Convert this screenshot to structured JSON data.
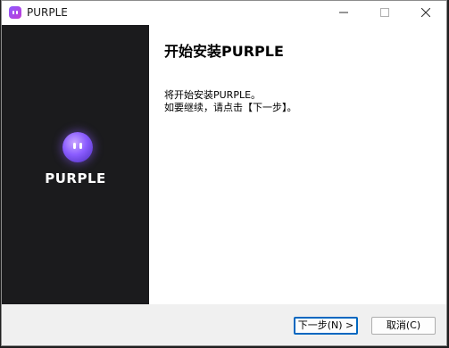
{
  "window": {
    "title": "PURPLE"
  },
  "sidebar": {
    "logo_text": "PURPLE"
  },
  "main": {
    "heading": "开始安装PURPLE",
    "line1": "将开始安装PURPLE。",
    "line2": "如要继续，请点击【下一步】。"
  },
  "footer": {
    "next_label": "下一步(N) >",
    "cancel_label": "取消(C)"
  },
  "icons": {
    "minimize": "minimize-icon",
    "maximize": "maximize-icon",
    "close": "close-icon",
    "app": "purple-app-icon"
  },
  "colors": {
    "sidebar_bg": "#1b1b1d",
    "accent": "#0067c0",
    "brand": "#8a5cff"
  }
}
